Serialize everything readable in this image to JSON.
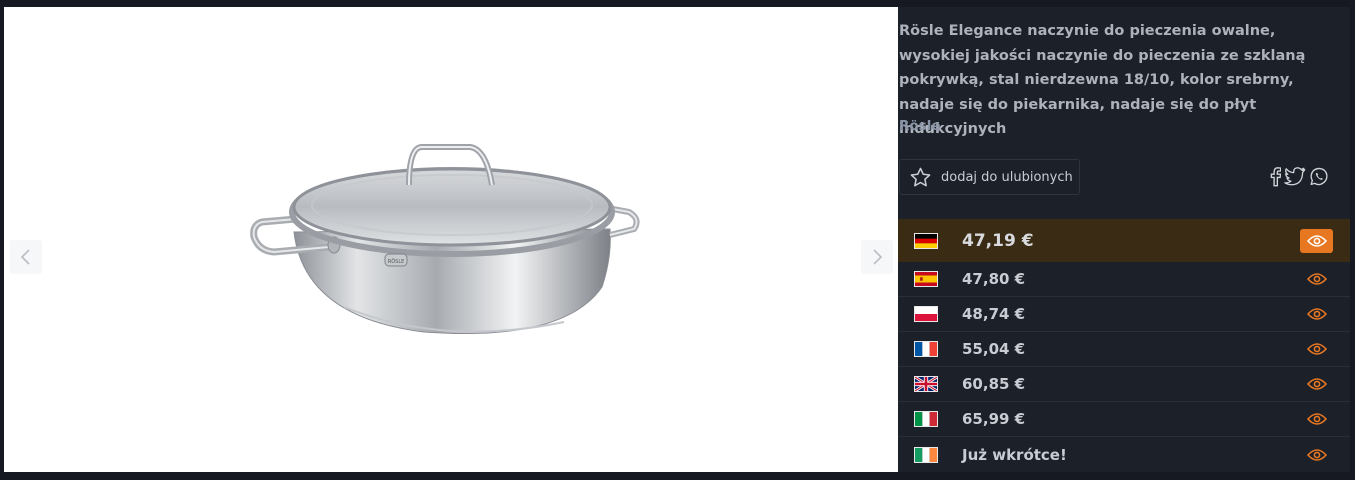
{
  "product": {
    "title": "Rösle Elegance naczynie do pieczenia owalne, wysokiej jakości naczynie do pieczenia ze szklaną pokrywką, stal nierdzewna 18/10, kolor srebrny, nadaje się do piekarnika, nadaje się do płyt indukcyjnych",
    "brand": "Rösle",
    "image_alt": "Stainless steel oval roasting pan with glass lid",
    "pan_logo_text": "RÖSLE"
  },
  "favorite": {
    "label": "dodaj do ulubionych",
    "icon": "star-icon"
  },
  "share": {
    "icons": [
      "facebook-icon",
      "twitter-icon",
      "whatsapp-icon"
    ]
  },
  "colors": {
    "accent": "#e87722",
    "best_row_bg": "#3a2b14",
    "panel_bg": "#1c2028",
    "page_bg": "#161922"
  },
  "offers": [
    {
      "country": "DE",
      "flag": "germany-flag",
      "price": "47,19 €",
      "best": true
    },
    {
      "country": "ES",
      "flag": "spain-flag",
      "price": "47,80 €",
      "best": false
    },
    {
      "country": "PL",
      "flag": "poland-flag",
      "price": "48,74 €",
      "best": false
    },
    {
      "country": "FR",
      "flag": "france-flag",
      "price": "55,04 €",
      "best": false
    },
    {
      "country": "UK",
      "flag": "uk-flag",
      "price": "60,85 €",
      "best": false
    },
    {
      "country": "IT",
      "flag": "italy-flag",
      "price": "65,99 €",
      "best": false
    },
    {
      "country": "IE",
      "flag": "ireland-flag",
      "price": "Już wkrótce!",
      "best": false
    }
  ]
}
